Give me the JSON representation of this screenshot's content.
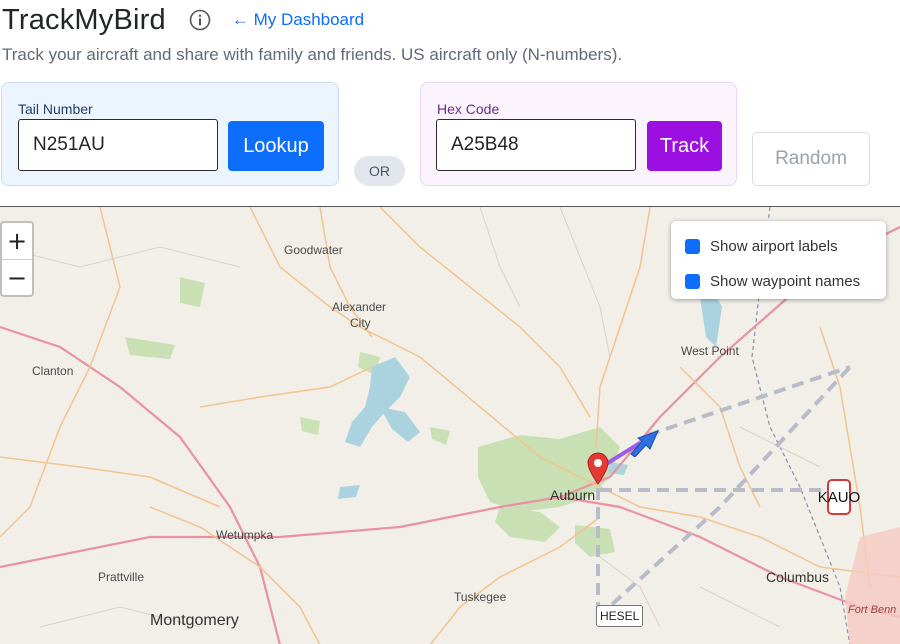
{
  "header": {
    "title": "TrackMyBird",
    "info_icon": "info-circle-icon",
    "dashboard_link": "← My Dashboard"
  },
  "subtitle": "Track your aircraft and share with family and friends. US aircraft only (N-numbers).",
  "tail_form": {
    "label": "Tail Number",
    "value": "N251AU",
    "button": "Lookup"
  },
  "or_label": "OR",
  "hex_form": {
    "label": "Hex Code",
    "value": "A25B48",
    "button": "Track"
  },
  "random_button": "Random",
  "map": {
    "zoom_in": "+",
    "zoom_out": "−",
    "layers": {
      "airport_labels": "Show airport labels",
      "waypoint_names": "Show waypoint names",
      "airport_labels_checked": true,
      "waypoint_names_checked": true
    },
    "place_labels": {
      "goodwater": "Goodwater",
      "alexander_1": "Alexander",
      "alexander_2": "City",
      "clanton": "Clanton",
      "west_point": "West Point",
      "auburn": "Auburn",
      "wetumpka": "Wetumpka",
      "prattville": "Prattville",
      "tuskegee": "Tuskegee",
      "montgomery": "Montgomery",
      "columbus": "Columbus",
      "fort_benning": "Fort Benn"
    },
    "airport_label": "KAUO",
    "waypoint_label": "HESEL",
    "colors": {
      "origin_marker": "#e53935",
      "aircraft": "#2f6fe0",
      "track_line": "#9b5de5",
      "route": "#b8bcc8"
    }
  }
}
